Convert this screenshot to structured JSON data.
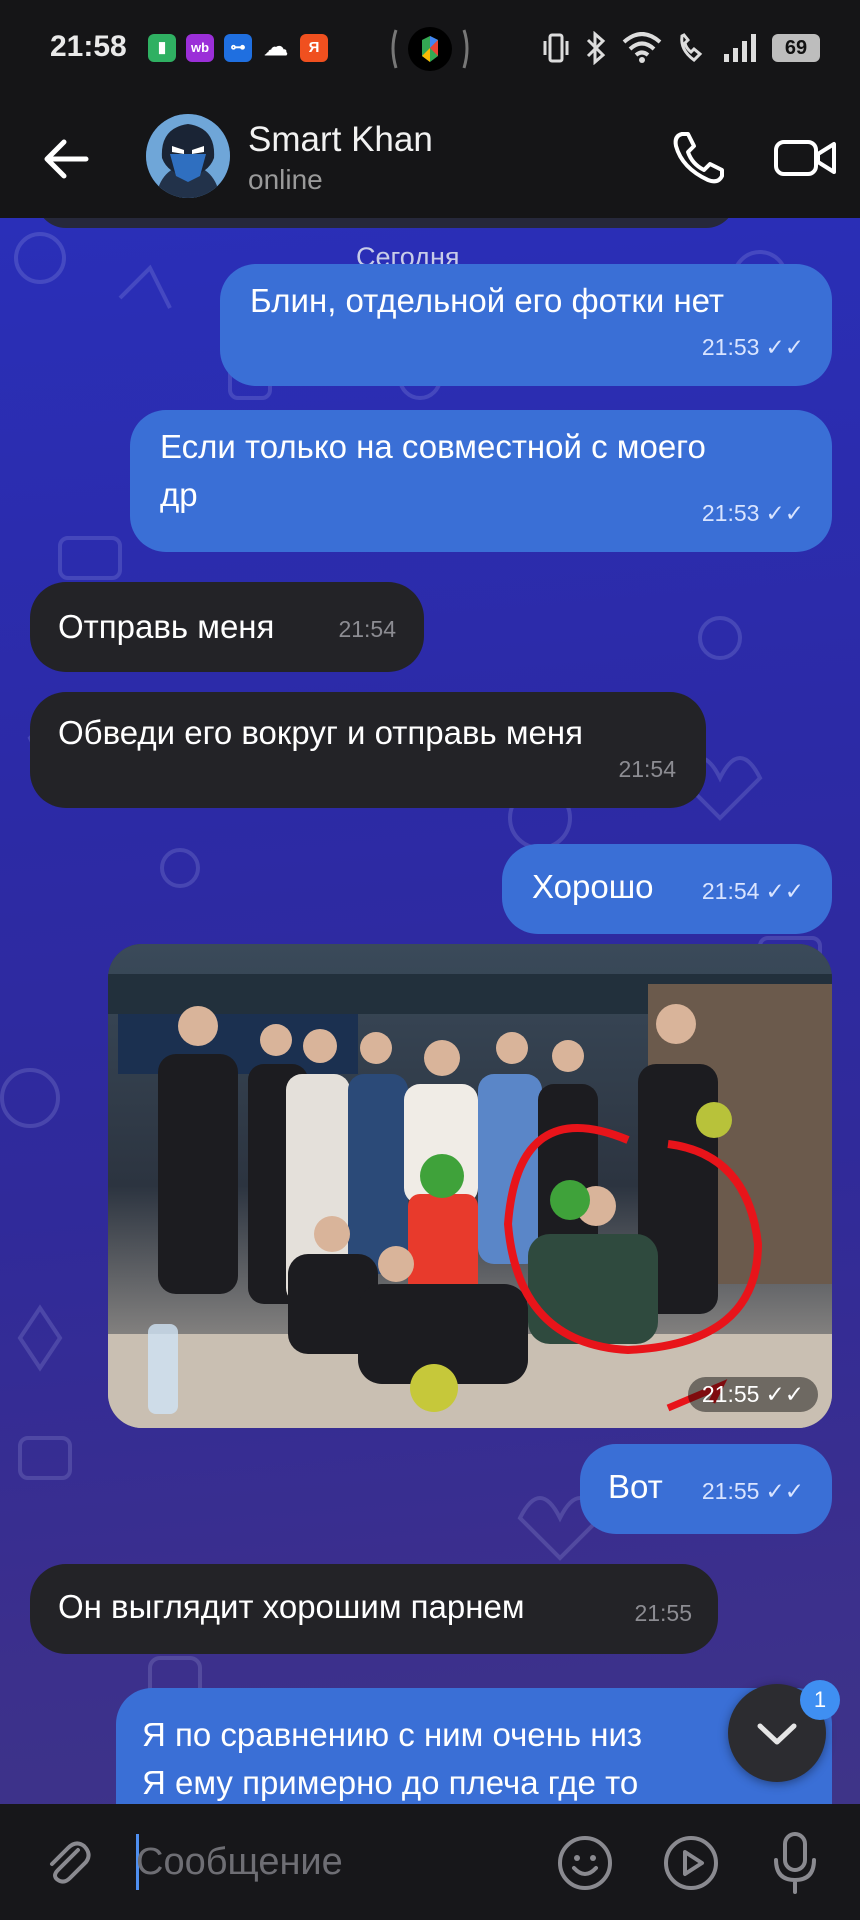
{
  "status_bar": {
    "time": "21:58",
    "battery": "69",
    "apps": [
      "battery-app",
      "wb",
      "key-app",
      "cloud",
      "Я"
    ]
  },
  "header": {
    "contact_name": "Smart Khan",
    "contact_status": "online"
  },
  "chat": {
    "date_label": "Сегодня",
    "messages": [
      {
        "direction": "out",
        "text": "Блин, отдельной его фотки нет",
        "time": "21:53",
        "read": true
      },
      {
        "direction": "out",
        "text_line1": "Если только на совместной с моего",
        "text_line2": "др",
        "time": "21:53",
        "read": true
      },
      {
        "direction": "in",
        "text": "Отправь меня",
        "time": "21:54"
      },
      {
        "direction": "in",
        "text": "Обведи его вокруг и отправь меня",
        "time": "21:54"
      },
      {
        "direction": "out",
        "text": "Хорошо",
        "time": "21:54",
        "read": true
      },
      {
        "direction": "out",
        "type": "photo",
        "time": "21:55",
        "read": true
      },
      {
        "direction": "out",
        "text": "Вот",
        "time": "21:55",
        "read": true
      },
      {
        "direction": "in",
        "text": "Он выглядит хорошим парнем",
        "time": "21:55"
      },
      {
        "direction": "out",
        "text_line1": "Я по сравнению с ним очень низ",
        "text_line2": "Я ему примерно до плеча где то"
      }
    ],
    "unread_badge": "1"
  },
  "input": {
    "placeholder": "Сообщение"
  },
  "colors": {
    "outgoing_bubble": "#3a6fd6",
    "incoming_bubble": "#232327",
    "chat_bg": "#2c2aa6",
    "accent": "#3f8ff2",
    "annotation_circle": "#e8141a"
  }
}
